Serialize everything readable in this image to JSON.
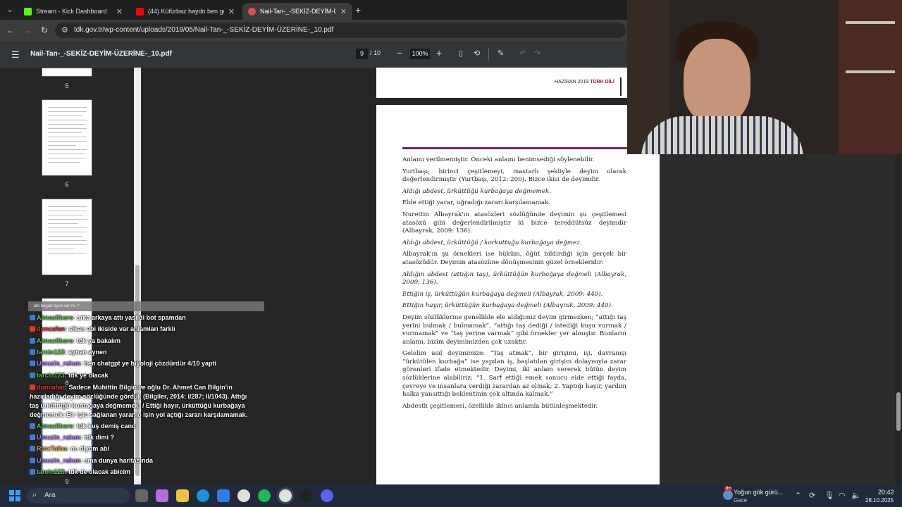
{
  "browser": {
    "tabs": [
      {
        "title": "Stream - Kick Dashboard",
        "color": "#53fc18"
      },
      {
        "title": "(44) Küfürbaz haydo ben gelem",
        "color": "#ff0000"
      },
      {
        "title": "Nail-Tan-_-SEKİZ-DEYİM-ÜZERİ",
        "color": "#d9534f"
      }
    ],
    "url": "tdk.gov.tr/wp-content/uploads/2019/05/Nail-Tan-_-SEKİZ-DEYİM-ÜZERİNE-_10.pdf"
  },
  "pdf": {
    "title": "Nail-Tan-_-SEKİZ-DEYİM-ÜZERİNE-_10.pdf",
    "current_page": "9",
    "total_pages": "/ 10",
    "zoom": "100%",
    "thumbnails": [
      "5",
      "6",
      "7",
      "8",
      "9"
    ],
    "header": {
      "date": "HAZİRAN 2019",
      "brand": "TÜRK DİLİ"
    },
    "paragraphs": [
      {
        "text": "Anlamı verilmemiştir. Önceki anlamı benimsediği söylenebilir.",
        "italic": false
      },
      {
        "text": "Yurtbaşı; birinci çeşitlemeyi, mastarlı şekliyle deyim olarak değerlendirmiştir (Yurtbaşı, 2012: 200). Bizce ikisi de deyimdir.",
        "italic": false
      },
      {
        "text": "Aldığı abdest, ürküttüğü kurbağaya değmemek.",
        "italic": true
      },
      {
        "text": "Elde ettiği yarar, uğradığı zararı karşılamamak.",
        "italic": false
      },
      {
        "text": "Nurettin Albayrak'ın atasözleri sözlüğünde deyimin şu çeşitlemesi atasözü gibi değerlendirilmiştir ki bizce tereddütsüz deyimdir (Albayrak, 2009: 136).",
        "italic": false
      },
      {
        "text": "Aldığı abdest, ürküttüğü / korkuttuğu kurbağaya değmez.",
        "italic": true
      },
      {
        "text": "Albayrak'ın şu örnekleri ise hüküm, öğüt bildirdiği için gerçek bir atasözüdür. Deyimin atasözüne dönüşmesinin güzel örnekleridir:",
        "italic": false
      },
      {
        "text": "Aldığın abdest (attığın taş), ürküttüğün kurbağaya değmeli (Albayrak, 2009: 136).",
        "italic": true
      },
      {
        "text": "Ettiğin iş, ürküttüğün kurbağaya değmeli (Albayrak, 2009: 440).",
        "italic": true
      },
      {
        "text": "Ettiğin hayır, ürküttüğün kurbağaya değmeli (Albayrak, 2009: 440).",
        "italic": true
      },
      {
        "text": "Deyim sözlüklerine genellikle ele aldığımız deyim girmezken; “attığı taş yerini bulmak / bulmamak”, “attığı taş dediği / istediği kuşu vurmak / vurmamak” ve “taş yerine varmak” gibi örnekler yer almıştır. Bunların anlamı, bizim deyimimizden çok uzaktır.",
        "italic": false
      },
      {
        "text": "Gelelim asıl deyimimize: “Taş atmak”, bir girişimi, işi, davranışı “ürkütülen kurbağa” ise yapılan iş, başlatılan girişim dolayısıyla zarar görenleri ifade etmektedir. Deyimi, iki anlam vererek bütün deyim sözlüklerine alabiliriz: “1. Sarf ettiği emek sonucu elde ettiği fayda, çevreye ve insanlara verdiği zarardan az olmak; 2. Yaptığı hayır, yardım halka yansıttığı beklentinin çok altında kalmak.”",
        "italic": false
      },
      {
        "text": "Abdestli çeşitlemesi, özellikle ikinci anlamla bütünleşmektedir.",
        "italic": false
      }
    ]
  },
  "chat": {
    "banner": "abi bugun oyun var mı ?",
    "messages": [
      {
        "user": "Almaalibaro",
        "text": ": arka arkaya attı yasildi bot spamdan",
        "color": "green"
      },
      {
        "user": "doncafan",
        "text": ": sikan abi ikiside var anlamları farklı",
        "color": "red"
      },
      {
        "user": "Almaalibaro",
        "text": ": tdk ya bakalım",
        "color": "green"
      },
      {
        "user": "tarcin123",
        "text": ": aynen aynen",
        "color": "green"
      },
      {
        "user": "Umuzin_rakun",
        "text": ": ben chatgpt ye biyoloji çözdürdür 4/10 yapti",
        "color": "purple"
      },
      {
        "user": "tarcin123",
        "text": ": tdk ye olacak",
        "color": "green"
      },
      {
        "user": "doncafan",
        "text": ": Sadece Muhittin Bilgin ve oğlu Dr. Ahmet Can Bilgin'in hazırladığı deyim sözlüğünde gördük (Bilgiler, 2014: I/287; II/1043). Attığı taş ürküttüğü kurbağaya değmemek: / Ettiği hayır, ürküttüğü kurbağaya değmemek: Bir işle sağlanan yarar, o işin yol açtığı zararı karşılamamak.",
        "color": "red"
      },
      {
        "user": "Almaalibaro",
        "text": ": tdk kuş demiş cano",
        "color": "green"
      },
      {
        "user": "Umuzin_rakun",
        "text": ": tdk dimi ?",
        "color": "purple"
      },
      {
        "user": "RmxTalha",
        "text": ": ne diyom abi",
        "color": "orange"
      },
      {
        "user": "Umuzin_rakun",
        "text": ": ama dunya haritasında",
        "color": "purple"
      },
      {
        "user": "tarcin123",
        "text": ": tdk de olacak abicim",
        "color": "green"
      }
    ]
  },
  "taskbar": {
    "search_label": "Ara",
    "weather_title": "Yoğun gök gürü...",
    "weather_sub": "Gece",
    "weather_badge": "9+",
    "time": "20:42",
    "date": "28.10.2025"
  }
}
